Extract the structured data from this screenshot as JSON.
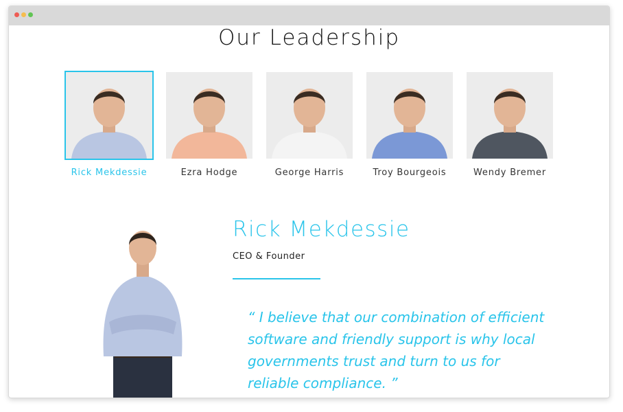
{
  "window": {
    "dots": [
      "#ee5c54",
      "#f5bd4f",
      "#61c454"
    ]
  },
  "page": {
    "title": "Our Leadership"
  },
  "accent_color": "#29c4ea",
  "team": [
    {
      "name": "Rick Mekdessie",
      "active": true,
      "shirt": "#b9c6e2"
    },
    {
      "name": "Ezra Hodge",
      "active": false,
      "shirt": "#f2b79a"
    },
    {
      "name": "George Harris",
      "active": false,
      "shirt": "#f4f4f4"
    },
    {
      "name": "Troy Bourgeois",
      "active": false,
      "shirt": "#7b98d6"
    },
    {
      "name": "Wendy Bremer",
      "active": false,
      "shirt": "#4f5660"
    }
  ],
  "profile": {
    "name": "Rick Mekdessie",
    "role": "CEO & Founder",
    "quote": "“ I believe that our combination of efficient software and friendly support is why local governments trust and turn to us for reliable compliance. ”"
  }
}
